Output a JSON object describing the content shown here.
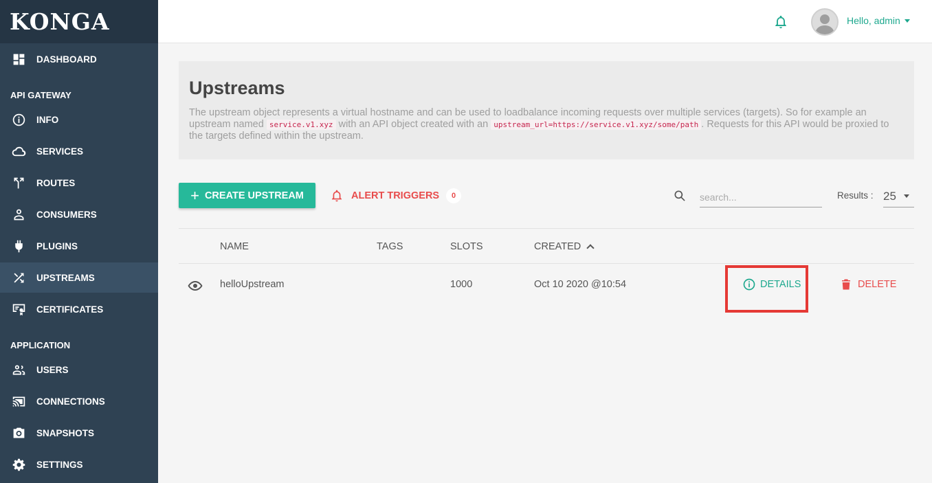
{
  "brand": {
    "name": "KONGA"
  },
  "sidebar": {
    "items": [
      {
        "label": "DASHBOARD",
        "icon": "dashboard-icon"
      },
      {
        "label": "INFO",
        "icon": "info-icon"
      },
      {
        "label": "SERVICES",
        "icon": "cloud-icon"
      },
      {
        "label": "ROUTES",
        "icon": "routes-icon"
      },
      {
        "label": "CONSUMERS",
        "icon": "person-icon"
      },
      {
        "label": "PLUGINS",
        "icon": "plug-icon"
      },
      {
        "label": "UPSTREAMS",
        "icon": "shuffle-icon",
        "active": true
      },
      {
        "label": "CERTIFICATES",
        "icon": "certificate-icon"
      },
      {
        "label": "USERS",
        "icon": "users-icon"
      },
      {
        "label": "CONNECTIONS",
        "icon": "cast-icon"
      },
      {
        "label": "SNAPSHOTS",
        "icon": "camera-icon"
      },
      {
        "label": "SETTINGS",
        "icon": "gear-icon"
      }
    ],
    "sections": {
      "api_gateway": "API GATEWAY",
      "application": "APPLICATION"
    }
  },
  "topbar": {
    "greeting": "Hello, admin"
  },
  "info": {
    "title": "Upstreams",
    "desc_part1": "The upstream object represents a virtual hostname and can be used to loadbalance incoming requests over multiple services (targets). So for example an upstream named ",
    "code1": "service.v1.xyz",
    "desc_part2": " with an API object created with an ",
    "code2": "upstream_url=https://service.v1.xyz/some/path",
    "desc_part3": ". Requests for this API would be proxied to the targets defined within the upstream."
  },
  "toolbar": {
    "create_label": "CREATE UPSTREAM",
    "create_icon": "+",
    "alert_label": "ALERT TRIGGERS",
    "alert_count": "0",
    "search_placeholder": "search...",
    "results_label": "Results :",
    "results_value": "25"
  },
  "table": {
    "headers": {
      "name": "NAME",
      "tags": "TAGS",
      "slots": "SLOTS",
      "created": "CREATED"
    },
    "rows": [
      {
        "name": "helloUpstream",
        "tags": "",
        "slots": "1000",
        "created": "Oct 10 2020 @10:54"
      }
    ],
    "actions": {
      "details": "DETAILS",
      "delete": "DELETE"
    }
  },
  "colors": {
    "accent": "#26b99a",
    "danger": "#e84c4c",
    "sidebar": "#2f4253",
    "highlight": "#e53935"
  }
}
